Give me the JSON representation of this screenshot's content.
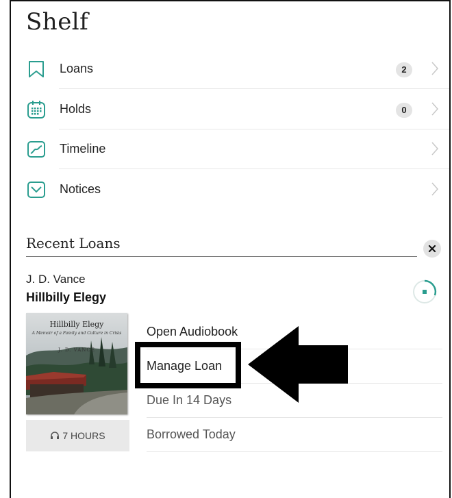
{
  "shelf": {
    "title": "Shelf",
    "items": [
      {
        "label": "Loans",
        "icon": "bookmark-icon",
        "badge": "2"
      },
      {
        "label": "Holds",
        "icon": "calendar-icon",
        "badge": "0"
      },
      {
        "label": "Timeline",
        "icon": "chart-line-icon"
      },
      {
        "label": "Notices",
        "icon": "envelope-icon"
      }
    ]
  },
  "recent_loans": {
    "heading": "Recent Loans",
    "close_icon": "close-icon",
    "book": {
      "author": "J. D. Vance",
      "title": "Hillbilly Elegy",
      "cover_title": "Hillbilly Elegy",
      "cover_subtitle": "A Memoir of a Family and Culture in Crisis",
      "cover_author": "J. D. VANCE",
      "duration": "7 HOURS",
      "duration_icon": "headphones-icon",
      "progress_icon": "progress-ring-icon"
    },
    "actions": [
      {
        "label": "Open Audiobook"
      },
      {
        "label": "Manage Loan"
      },
      {
        "label": "Due In 14 Days"
      },
      {
        "label": "Borrowed Today"
      }
    ]
  },
  "colors": {
    "accent": "#2a9d8f",
    "text_secondary": "#555555",
    "badge_bg": "#e4e4e4",
    "highlight": "#000000"
  }
}
